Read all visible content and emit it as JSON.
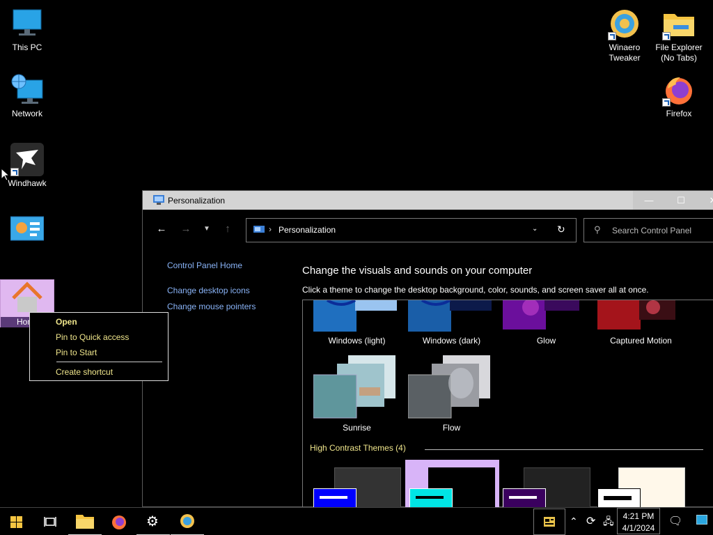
{
  "desktop": {
    "icons": [
      {
        "label": "This PC"
      },
      {
        "label": "Network"
      },
      {
        "label": "Windhawk"
      },
      {
        "label": ""
      },
      {
        "label": "Home"
      },
      {
        "label": "Winaero Tweaker"
      },
      {
        "label": "File Explorer (No Tabs)"
      },
      {
        "label": "Firefox"
      }
    ]
  },
  "window": {
    "title": "Personalization",
    "breadcrumb": "Personalization",
    "search_placeholder": "Search Control Panel",
    "left_links": {
      "home": "Control Panel Home",
      "desktop_icons": "Change desktop icons",
      "mouse_pointers": "Change mouse pointers"
    },
    "heading": "Change the visuals and sounds on your computer",
    "subheading": "Click a theme to change the desktop background, color, sounds, and screen saver all at once.",
    "themes": [
      {
        "name": "Windows (light)"
      },
      {
        "name": "Windows (dark)"
      },
      {
        "name": "Glow"
      },
      {
        "name": "Captured Motion"
      },
      {
        "name": "Sunrise"
      },
      {
        "name": "Flow"
      }
    ],
    "high_contrast_header": "High Contrast Themes (4)"
  },
  "context_menu": {
    "items": [
      "Open",
      "Pin to Quick access",
      "Pin to Start",
      "Create shortcut"
    ]
  },
  "taskbar": {
    "time": "4:21 PM",
    "date": "4/1/2024"
  },
  "colors": {
    "link": "#8ab4f8",
    "menu_text": "#f0e68c",
    "titlebar": "#d4d4d4"
  }
}
